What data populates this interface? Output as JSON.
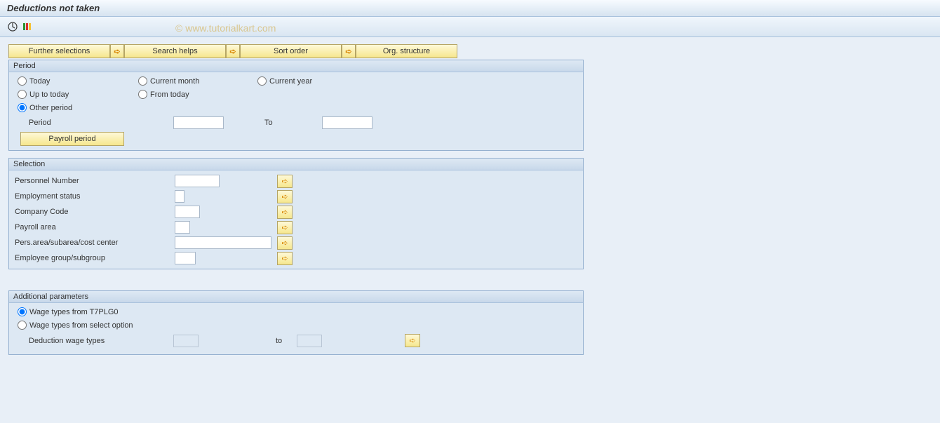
{
  "title": "Deductions not taken",
  "watermark": "© www.tutorialkart.com",
  "toolbar_buttons": {
    "further_selections": "Further selections",
    "search_helps": "Search helps",
    "sort_order": "Sort order",
    "org_structure": "Org. structure"
  },
  "period": {
    "header": "Period",
    "today": "Today",
    "current_month": "Current month",
    "current_year": "Current year",
    "up_to_today": "Up to today",
    "from_today": "From today",
    "other_period": "Other period",
    "period_label": "Period",
    "to_label": "To",
    "payroll_period_btn": "Payroll period"
  },
  "selection": {
    "header": "Selection",
    "personnel_number": "Personnel Number",
    "employment_status": "Employment status",
    "company_code": "Company Code",
    "payroll_area": "Payroll area",
    "pers_area": "Pers.area/subarea/cost center",
    "employee_group": "Employee group/subgroup"
  },
  "additional": {
    "header": "Additional parameters",
    "wage_t7plg0": "Wage types from T7PLG0",
    "wage_select": "Wage types from select option",
    "deduction_label": "Deduction wage types",
    "to_label": "to"
  }
}
